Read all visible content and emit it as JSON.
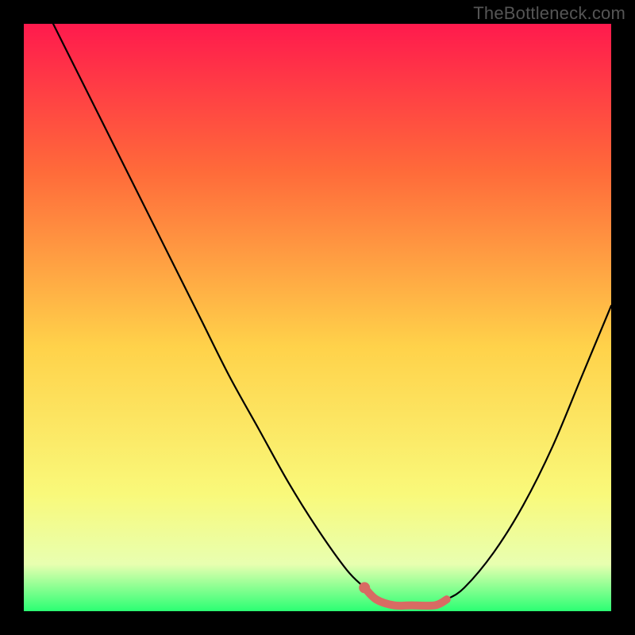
{
  "watermark": "TheBottleneck.com",
  "colors": {
    "background": "#000000",
    "gradient_top": "#ff1a4d",
    "gradient_mid_upper": "#ff6a3a",
    "gradient_mid": "#ffd24a",
    "gradient_mid_lower": "#f9f97a",
    "gradient_lower": "#e8ffb0",
    "gradient_bottom": "#2bff73",
    "curve": "#000000",
    "highlight": "#d86b63",
    "dot": "#d86b63"
  },
  "chart_data": {
    "type": "line",
    "title": "",
    "xlabel": "",
    "ylabel": "",
    "xlim": [
      0,
      100
    ],
    "ylim": [
      0,
      100
    ],
    "grid": false,
    "series": [
      {
        "name": "curve",
        "x": [
          5,
          10,
          15,
          20,
          25,
          30,
          35,
          40,
          45,
          50,
          55,
          58,
          60,
          63,
          66,
          70,
          72,
          75,
          80,
          85,
          90,
          95,
          100
        ],
        "values": [
          100,
          90,
          80,
          70,
          60,
          50,
          40,
          31,
          22,
          14,
          7,
          4,
          2,
          1,
          1,
          1,
          2,
          4,
          10,
          18,
          28,
          40,
          52
        ]
      }
    ],
    "highlight_segment": {
      "on_series": "curve",
      "x": [
        58,
        60,
        63,
        66,
        70,
        72
      ],
      "values": [
        4,
        2,
        1,
        1,
        1,
        2
      ]
    },
    "highlight_point": {
      "x": 58,
      "y": 4
    }
  }
}
